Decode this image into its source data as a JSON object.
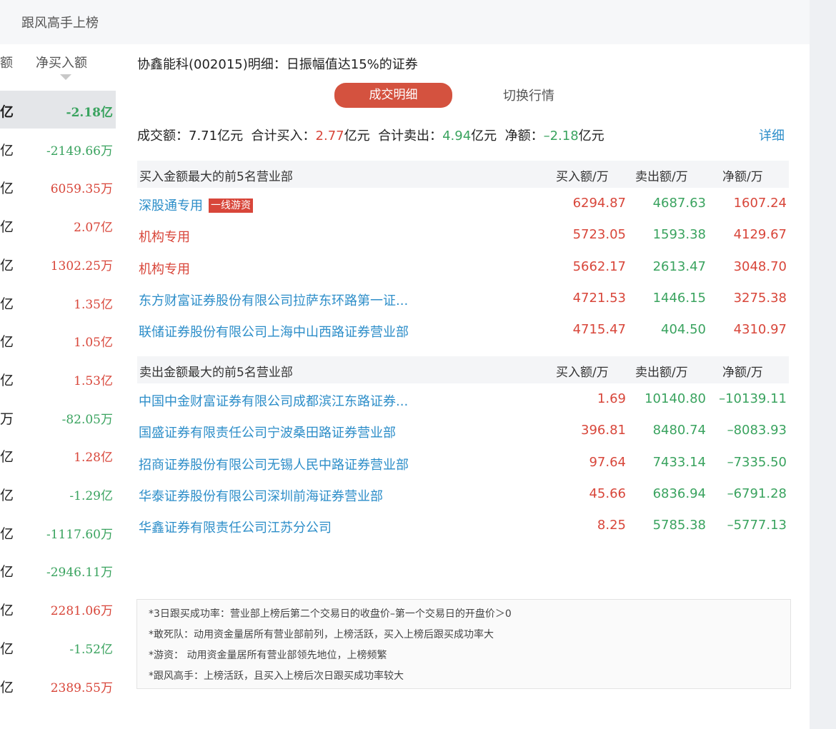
{
  "header": {
    "tab": "跟风高手上榜"
  },
  "left_table": {
    "cut_header": "额",
    "net_buy_header": "净买入额",
    "rows": [
      {
        "cut": "亿",
        "value": "-2.18亿",
        "color": "green",
        "selected": true
      },
      {
        "cut": "亿",
        "value": "-2149.66万",
        "color": "green"
      },
      {
        "cut": "亿",
        "value": "6059.35万",
        "color": "red"
      },
      {
        "cut": "亿",
        "value": "2.07亿",
        "color": "red"
      },
      {
        "cut": "亿",
        "value": "1302.25万",
        "color": "red"
      },
      {
        "cut": "亿",
        "value": "1.35亿",
        "color": "red"
      },
      {
        "cut": "亿",
        "value": "1.05亿",
        "color": "red"
      },
      {
        "cut": "亿",
        "value": "1.53亿",
        "color": "red"
      },
      {
        "cut": "万",
        "value": "-82.05万",
        "color": "green"
      },
      {
        "cut": "亿",
        "value": "1.28亿",
        "color": "red"
      },
      {
        "cut": "亿",
        "value": "-1.29亿",
        "color": "green"
      },
      {
        "cut": "亿",
        "value": "-1117.60万",
        "color": "green"
      },
      {
        "cut": "亿",
        "value": "-2946.11万",
        "color": "green"
      },
      {
        "cut": "亿",
        "value": "2281.06万",
        "color": "red"
      },
      {
        "cut": "亿",
        "value": "-1.52亿",
        "color": "green"
      },
      {
        "cut": "亿",
        "value": "2389.55万",
        "color": "red"
      }
    ]
  },
  "detail": {
    "title": "协鑫能科(002015)明细：日振幅值达15%的证券",
    "btn_active": "成交明细",
    "btn_switch": "切换行情",
    "summary": {
      "turnover_label": "成交额：",
      "turnover": "7.71亿元",
      "buy_label": "合计买入：",
      "buy_value": "2.77",
      "buy_unit": "亿元",
      "sell_label": "合计卖出：",
      "sell_value": "4.94",
      "sell_unit": "亿元",
      "net_label": "净额：",
      "net_value": "–2.18",
      "net_unit": "亿元"
    },
    "detail_link": "详细",
    "buy_section": {
      "title": "买入金额最大的前5名营业部",
      "col_buy": "买入额/万",
      "col_sell": "卖出额/万",
      "col_net": "净额/万",
      "rows": [
        {
          "name": "深股通专用",
          "tag": "一线游资",
          "name_color": "blue",
          "buy": "6294.87",
          "sell": "4687.63",
          "net": "1607.24",
          "net_color": "red"
        },
        {
          "name": "机构专用",
          "tag": "",
          "name_color": "red",
          "buy": "5723.05",
          "sell": "1593.38",
          "net": "4129.67",
          "net_color": "red"
        },
        {
          "name": "机构专用",
          "tag": "",
          "name_color": "red",
          "buy": "5662.17",
          "sell": "2613.47",
          "net": "3048.70",
          "net_color": "red"
        },
        {
          "name": "东方财富证券股份有限公司拉萨东环路第一证...",
          "tag": "",
          "name_color": "blue",
          "buy": "4721.53",
          "sell": "1446.15",
          "net": "3275.38",
          "net_color": "red"
        },
        {
          "name": "联储证券股份有限公司上海中山西路证券营业部",
          "tag": "",
          "name_color": "blue",
          "buy": "4715.47",
          "sell": "404.50",
          "net": "4310.97",
          "net_color": "red"
        }
      ]
    },
    "sell_section": {
      "title": "卖出金额最大的前5名营业部",
      "col_buy": "买入额/万",
      "col_sell": "卖出额/万",
      "col_net": "净额/万",
      "rows": [
        {
          "name": "中国中金财富证券有限公司成都滨江东路证券...",
          "tag": "",
          "name_color": "blue",
          "buy": "1.69",
          "sell": "10140.80",
          "net": "–10139.11",
          "net_color": "green"
        },
        {
          "name": "国盛证券有限责任公司宁波桑田路证券营业部",
          "tag": "",
          "name_color": "blue",
          "buy": "396.81",
          "sell": "8480.74",
          "net": "–8083.93",
          "net_color": "green"
        },
        {
          "name": "招商证券股份有限公司无锡人民中路证券营业部",
          "tag": "",
          "name_color": "blue",
          "buy": "97.64",
          "sell": "7433.14",
          "net": "–7335.50",
          "net_color": "green"
        },
        {
          "name": "华泰证券股份有限公司深圳前海证券营业部",
          "tag": "",
          "name_color": "blue",
          "buy": "45.66",
          "sell": "6836.94",
          "net": "–6791.28",
          "net_color": "green"
        },
        {
          "name": "华鑫证券有限责任公司江苏分公司",
          "tag": "",
          "name_color": "blue",
          "buy": "8.25",
          "sell": "5785.38",
          "net": "–5777.13",
          "net_color": "green"
        }
      ]
    },
    "notes": [
      "*3日跟买成功率：营业部上榜后第二个交易日的收盘价–第一个交易日的开盘价＞0",
      "*敢死队：动用资金量居所有营业部前列，上榜活跃，买入上榜后跟买成功率大",
      "*游资：  动用资金量居所有营业部领先地位，上榜频繁",
      "*跟风高手：上榜活跃，且买入上榜后次日跟买成功率较大"
    ]
  },
  "colors": {
    "red": "#d8463a",
    "green": "#3aa35f",
    "blue": "#2d8ec9",
    "accent_button": "#d4523f"
  }
}
